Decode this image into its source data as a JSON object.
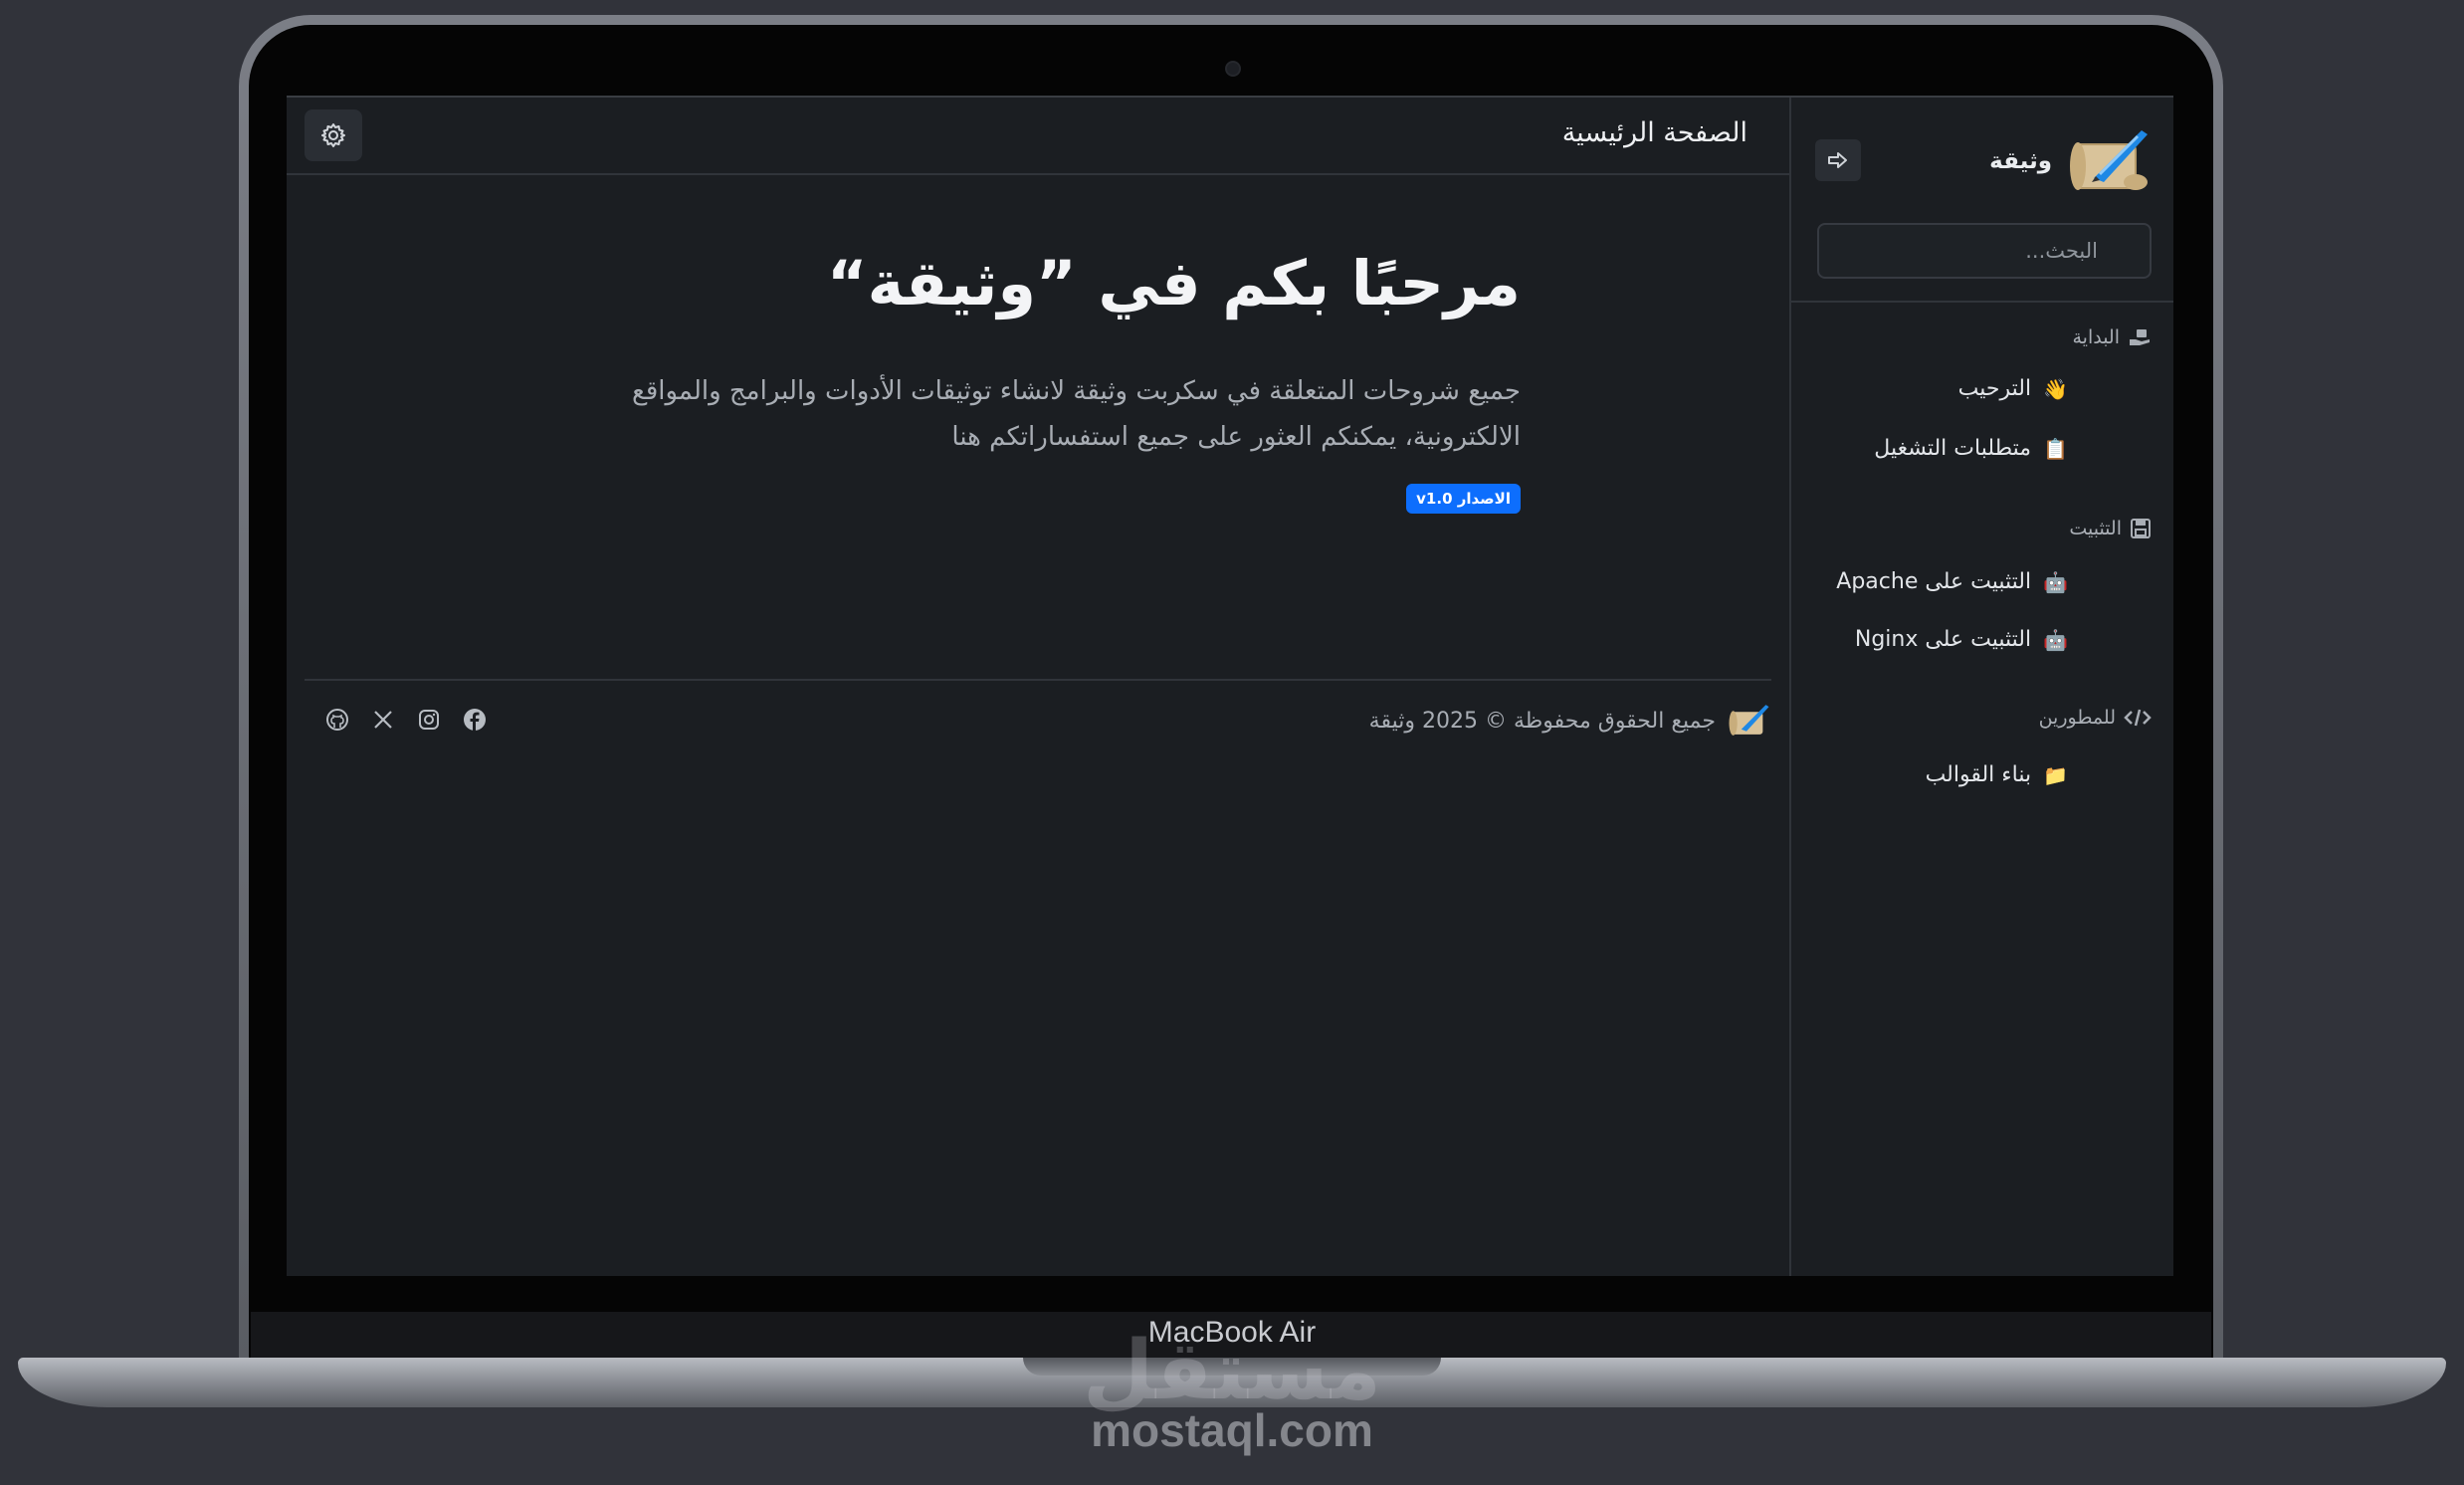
{
  "device": {
    "model_label": "MacBook Air",
    "watermark_logo": "مستقل",
    "watermark_url": "mostaql.com"
  },
  "sidebar": {
    "brand_name": "وثيقة",
    "brand_logo_icon": "scroll-quill-logo",
    "collapse_icon": "sign-out-arrow-icon",
    "search": {
      "placeholder": "البحث...",
      "value": ""
    },
    "sections": [
      {
        "title": "البداية",
        "icon": "hand-holding-icon",
        "items": [
          {
            "label": "الترحيب",
            "icon": "waving-hand-emoji"
          },
          {
            "label": "متطلبات التشغيل",
            "icon": "clipboard-emoji"
          }
        ]
      },
      {
        "title": "التثبيت",
        "icon": "floppy-disk-icon",
        "items": [
          {
            "label": "التثبيت على Apache",
            "icon": "robot-emoji"
          },
          {
            "label": "التثبيت على Nginx",
            "icon": "robot-emoji"
          }
        ]
      },
      {
        "title": "للمطورين",
        "icon": "code-icon",
        "items": [
          {
            "label": "بناء القوالب",
            "icon": "folder-emoji"
          }
        ]
      }
    ]
  },
  "header": {
    "page_title": "الصفحة الرئيسية",
    "theme_toggle_icon": "gear-icon"
  },
  "hero": {
    "title": "مرحبًا بكم في ”وثيقة“",
    "description": "جميع شروحات المتعلقة في سكربت وثيقة لانشاء توثيقات الأدوات والبرامج والمواقع الالكترونية، يمكنكم العثور على جميع استفساراتكم هنا",
    "badge": "الاصدار v1.0"
  },
  "footer": {
    "copyright": "جميع الحقوق محفوظة © 2025 وثيقة",
    "socials": [
      {
        "name": "facebook",
        "icon": "facebook-icon"
      },
      {
        "name": "instagram",
        "icon": "instagram-icon"
      },
      {
        "name": "x",
        "icon": "x-twitter-icon"
      },
      {
        "name": "github",
        "icon": "github-icon"
      }
    ]
  },
  "colors": {
    "background": "#1b1e22",
    "border": "#30343a",
    "accent": "#0d6efd",
    "text_primary": "#f3f4f6",
    "text_muted": "#a8adb4"
  }
}
